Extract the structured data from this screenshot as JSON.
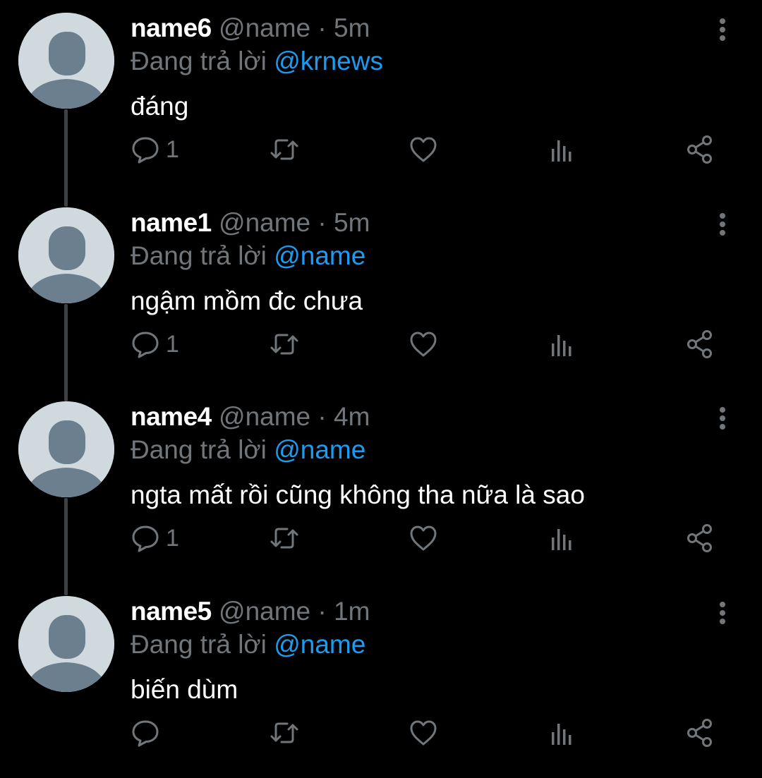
{
  "colors": {
    "background": "#000000",
    "name": "#ffffff",
    "secondary": "#71767b",
    "mention": "#1d9bf0",
    "avatar_bg": "#cfd9de",
    "avatar_fg": "#6b7f8e"
  },
  "tweets": [
    {
      "name": "name6",
      "handle": "@name",
      "separator": "·",
      "time": "5m",
      "replying_prefix": "Đang trả lời",
      "replying_to": "@krnews",
      "text": "đáng",
      "reply_count": "1",
      "icons": [
        "reply-icon",
        "retweet-icon",
        "like-icon",
        "views-icon",
        "share-icon",
        "more-icon"
      ]
    },
    {
      "name": "name1",
      "handle": "@name",
      "separator": "·",
      "time": "5m",
      "replying_prefix": "Đang trả lời",
      "replying_to": "@name",
      "text": "ngậm mồm đc chưa",
      "reply_count": "1",
      "icons": [
        "reply-icon",
        "retweet-icon",
        "like-icon",
        "views-icon",
        "share-icon",
        "more-icon"
      ]
    },
    {
      "name": "name4",
      "handle": "@name",
      "separator": "·",
      "time": "4m",
      "replying_prefix": "Đang trả lời",
      "replying_to": "@name",
      "text": "ngta mất rồi cũng không tha nữa là sao",
      "reply_count": "1",
      "icons": [
        "reply-icon",
        "retweet-icon",
        "like-icon",
        "views-icon",
        "share-icon",
        "more-icon"
      ]
    },
    {
      "name": "name5",
      "handle": "@name",
      "separator": "·",
      "time": "1m",
      "replying_prefix": "Đang trả lời",
      "replying_to": "@name",
      "text": "biến dùm",
      "reply_count": "",
      "icons": [
        "reply-icon",
        "retweet-icon",
        "like-icon",
        "views-icon",
        "share-icon",
        "more-icon"
      ]
    }
  ]
}
